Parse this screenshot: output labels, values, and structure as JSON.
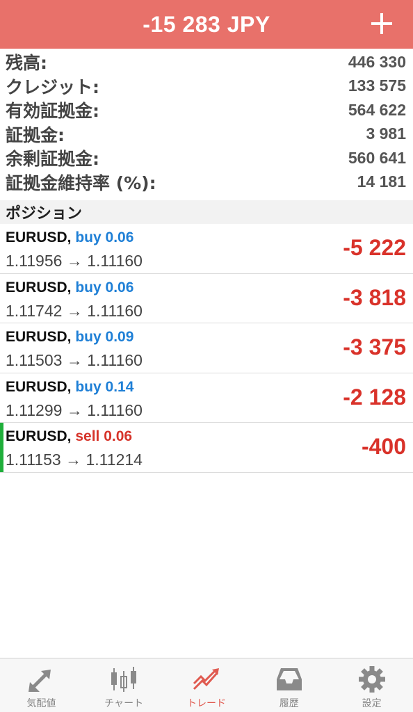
{
  "header": {
    "title": "-15 283 JPY",
    "add_icon": "plus-icon"
  },
  "summary": [
    {
      "label": "残高:",
      "value": "446 330"
    },
    {
      "label": "クレジット:",
      "value": "133 575"
    },
    {
      "label": "有効証拠金:",
      "value": "564 622"
    },
    {
      "label": "証拠金:",
      "value": "3 981"
    },
    {
      "label": "余剰証拠金:",
      "value": "560 641"
    },
    {
      "label": "証拠金維持率 (%):",
      "value": "14 181"
    }
  ],
  "section": {
    "title": "ポジション"
  },
  "positions": [
    {
      "symbol": "EURUSD,",
      "side": "buy 0.06",
      "prices": "1.11956 → 1.11160",
      "profit": "-5 222"
    },
    {
      "symbol": "EURUSD,",
      "side": "buy 0.06",
      "prices": "1.11742 → 1.11160",
      "profit": "-3 818"
    },
    {
      "symbol": "EURUSD,",
      "side": "buy 0.09",
      "prices": "1.11503 → 1.11160",
      "profit": "-3 375"
    },
    {
      "symbol": "EURUSD,",
      "side": "buy 0.14",
      "prices": "1.11299 → 1.11160",
      "profit": "-2 128"
    },
    {
      "symbol": "EURUSD,",
      "side": "sell 0.06",
      "prices": "1.11153 → 1.11214",
      "profit": "-400"
    }
  ],
  "tabs": [
    {
      "label": "気配値",
      "icon": "quotes-arrows-icon"
    },
    {
      "label": "チャート",
      "icon": "candlestick-chart-icon"
    },
    {
      "label": "トレード",
      "icon": "trade-trend-icon",
      "active": true
    },
    {
      "label": "履歴",
      "icon": "inbox-history-icon"
    },
    {
      "label": "設定",
      "icon": "gear-icon"
    }
  ],
  "colors": {
    "header_bg": "#e8716a",
    "buy": "#1e7fd6",
    "sell": "#d6342a",
    "profit_negative": "#d9322a",
    "sell_marker": "#1fae3a",
    "tab_active": "#e05a50",
    "tab_inactive": "#888888"
  }
}
